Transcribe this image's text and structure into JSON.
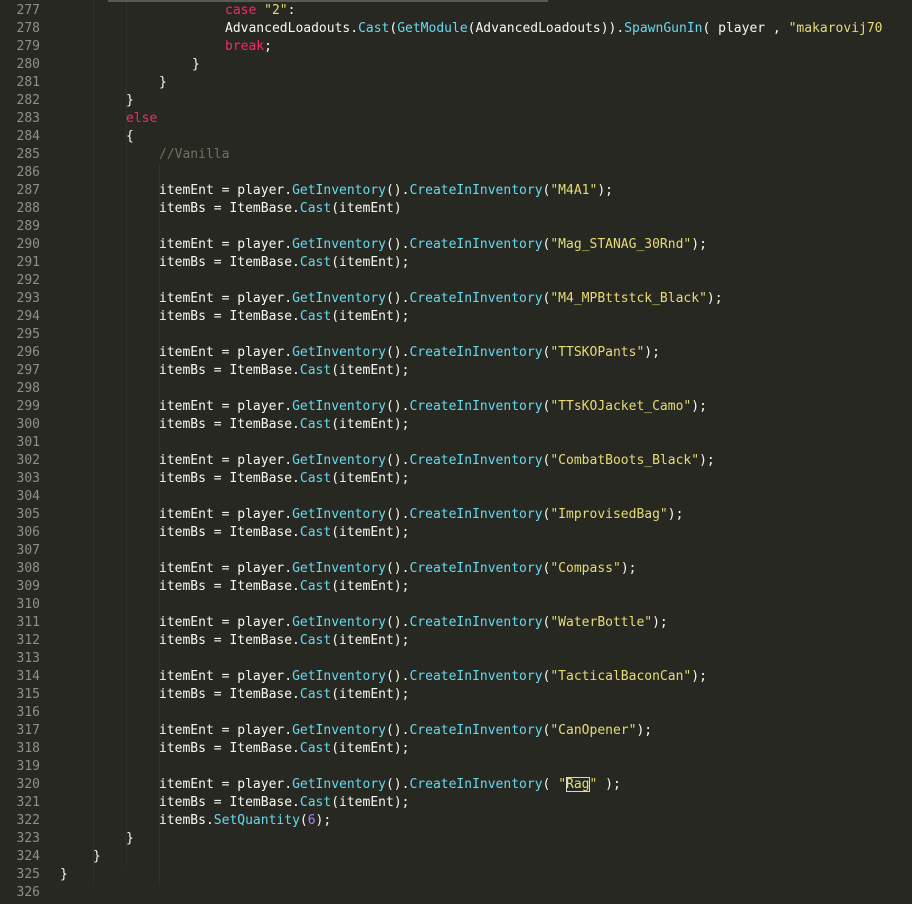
{
  "editor": {
    "colors": {
      "background": "#272822",
      "foreground": "#f8f8f2",
      "keyword": "#f92672",
      "string": "#e6db74",
      "function": "#66d9ef",
      "number": "#ae81ff",
      "comment": "#75715e",
      "gutter": "#90908a"
    },
    "lines": [
      {
        "num": "277",
        "indent": 5,
        "tokens": [
          {
            "t": "case ",
            "c": "kw"
          },
          {
            "t": "\"2\"",
            "c": "str"
          },
          {
            "t": ":"
          }
        ]
      },
      {
        "num": "278",
        "indent": 5,
        "tokens": [
          {
            "t": "AdvancedLoadouts."
          },
          {
            "t": "Cast",
            "c": "fn"
          },
          {
            "t": "("
          },
          {
            "t": "GetModule",
            "c": "fn"
          },
          {
            "t": "(AdvancedLoadouts))."
          },
          {
            "t": "SpawnGunIn",
            "c": "fn"
          },
          {
            "t": "( player , "
          },
          {
            "t": "\"makarovij70",
            "c": "str"
          }
        ]
      },
      {
        "num": "279",
        "indent": 5,
        "tokens": [
          {
            "t": "break",
            "c": "kw"
          },
          {
            "t": ";"
          }
        ]
      },
      {
        "num": "280",
        "indent": 4,
        "tokens": [
          {
            "t": "}"
          }
        ]
      },
      {
        "num": "281",
        "indent": 3,
        "tokens": [
          {
            "t": "}"
          }
        ]
      },
      {
        "num": "282",
        "indent": 2,
        "tokens": [
          {
            "t": "}"
          }
        ]
      },
      {
        "num": "283",
        "indent": 2,
        "tokens": [
          {
            "t": "else",
            "c": "kw"
          }
        ]
      },
      {
        "num": "284",
        "indent": 2,
        "tokens": [
          {
            "t": "{"
          }
        ]
      },
      {
        "num": "285",
        "indent": 3,
        "tokens": [
          {
            "t": "//Vanilla",
            "c": "cm"
          }
        ]
      },
      {
        "num": "286",
        "indent": 0,
        "tokens": []
      },
      {
        "num": "287",
        "indent": 3,
        "tokens": [
          {
            "t": "itemEnt = player."
          },
          {
            "t": "GetInventory",
            "c": "fn"
          },
          {
            "t": "()."
          },
          {
            "t": "CreateInInventory",
            "c": "fn"
          },
          {
            "t": "("
          },
          {
            "t": "\"M4A1\"",
            "c": "str"
          },
          {
            "t": ");"
          }
        ]
      },
      {
        "num": "288",
        "indent": 3,
        "tokens": [
          {
            "t": "itemBs = ItemBase."
          },
          {
            "t": "Cast",
            "c": "fn"
          },
          {
            "t": "(itemEnt)"
          }
        ]
      },
      {
        "num": "289",
        "indent": 0,
        "tokens": []
      },
      {
        "num": "290",
        "indent": 3,
        "tokens": [
          {
            "t": "itemEnt = player."
          },
          {
            "t": "GetInventory",
            "c": "fn"
          },
          {
            "t": "()."
          },
          {
            "t": "CreateInInventory",
            "c": "fn"
          },
          {
            "t": "("
          },
          {
            "t": "\"Mag_STANAG_30Rnd\"",
            "c": "str"
          },
          {
            "t": ");"
          }
        ]
      },
      {
        "num": "291",
        "indent": 3,
        "tokens": [
          {
            "t": "itemBs = ItemBase."
          },
          {
            "t": "Cast",
            "c": "fn"
          },
          {
            "t": "(itemEnt);"
          }
        ]
      },
      {
        "num": "292",
        "indent": 0,
        "tokens": []
      },
      {
        "num": "293",
        "indent": 3,
        "tokens": [
          {
            "t": "itemEnt = player."
          },
          {
            "t": "GetInventory",
            "c": "fn"
          },
          {
            "t": "()."
          },
          {
            "t": "CreateInInventory",
            "c": "fn"
          },
          {
            "t": "("
          },
          {
            "t": "\"M4_MPBttstck_Black\"",
            "c": "str"
          },
          {
            "t": ");"
          }
        ]
      },
      {
        "num": "294",
        "indent": 3,
        "tokens": [
          {
            "t": "itemBs = ItemBase."
          },
          {
            "t": "Cast",
            "c": "fn"
          },
          {
            "t": "(itemEnt);"
          }
        ]
      },
      {
        "num": "295",
        "indent": 0,
        "tokens": []
      },
      {
        "num": "296",
        "indent": 3,
        "tokens": [
          {
            "t": "itemEnt = player."
          },
          {
            "t": "GetInventory",
            "c": "fn"
          },
          {
            "t": "()."
          },
          {
            "t": "CreateInInventory",
            "c": "fn"
          },
          {
            "t": "("
          },
          {
            "t": "\"TTSKOPants\"",
            "c": "str"
          },
          {
            "t": ");"
          }
        ]
      },
      {
        "num": "297",
        "indent": 3,
        "tokens": [
          {
            "t": "itemBs = ItemBase."
          },
          {
            "t": "Cast",
            "c": "fn"
          },
          {
            "t": "(itemEnt);"
          }
        ]
      },
      {
        "num": "298",
        "indent": 0,
        "tokens": []
      },
      {
        "num": "299",
        "indent": 3,
        "tokens": [
          {
            "t": "itemEnt = player."
          },
          {
            "t": "GetInventory",
            "c": "fn"
          },
          {
            "t": "()."
          },
          {
            "t": "CreateInInventory",
            "c": "fn"
          },
          {
            "t": "("
          },
          {
            "t": "\"TTsKOJacket_Camo\"",
            "c": "str"
          },
          {
            "t": ");"
          }
        ]
      },
      {
        "num": "300",
        "indent": 3,
        "tokens": [
          {
            "t": "itemBs = ItemBase."
          },
          {
            "t": "Cast",
            "c": "fn"
          },
          {
            "t": "(itemEnt);"
          }
        ]
      },
      {
        "num": "301",
        "indent": 0,
        "tokens": []
      },
      {
        "num": "302",
        "indent": 3,
        "tokens": [
          {
            "t": "itemEnt = player."
          },
          {
            "t": "GetInventory",
            "c": "fn"
          },
          {
            "t": "()."
          },
          {
            "t": "CreateInInventory",
            "c": "fn"
          },
          {
            "t": "("
          },
          {
            "t": "\"CombatBoots_Black\"",
            "c": "str"
          },
          {
            "t": ");"
          }
        ]
      },
      {
        "num": "303",
        "indent": 3,
        "tokens": [
          {
            "t": "itemBs = ItemBase."
          },
          {
            "t": "Cast",
            "c": "fn"
          },
          {
            "t": "(itemEnt);"
          }
        ]
      },
      {
        "num": "304",
        "indent": 0,
        "tokens": []
      },
      {
        "num": "305",
        "indent": 3,
        "tokens": [
          {
            "t": "itemEnt = player."
          },
          {
            "t": "GetInventory",
            "c": "fn"
          },
          {
            "t": "()."
          },
          {
            "t": "CreateInInventory",
            "c": "fn"
          },
          {
            "t": "("
          },
          {
            "t": "\"ImprovisedBag\"",
            "c": "str"
          },
          {
            "t": ");"
          }
        ]
      },
      {
        "num": "306",
        "indent": 3,
        "tokens": [
          {
            "t": "itemBs = ItemBase."
          },
          {
            "t": "Cast",
            "c": "fn"
          },
          {
            "t": "(itemEnt);"
          }
        ]
      },
      {
        "num": "307",
        "indent": 0,
        "tokens": []
      },
      {
        "num": "308",
        "indent": 3,
        "tokens": [
          {
            "t": "itemEnt = player."
          },
          {
            "t": "GetInventory",
            "c": "fn"
          },
          {
            "t": "()."
          },
          {
            "t": "CreateInInventory",
            "c": "fn"
          },
          {
            "t": "("
          },
          {
            "t": "\"Compass\"",
            "c": "str"
          },
          {
            "t": ");"
          }
        ]
      },
      {
        "num": "309",
        "indent": 3,
        "tokens": [
          {
            "t": "itemBs = ItemBase."
          },
          {
            "t": "Cast",
            "c": "fn"
          },
          {
            "t": "(itemEnt);"
          }
        ]
      },
      {
        "num": "310",
        "indent": 0,
        "tokens": []
      },
      {
        "num": "311",
        "indent": 3,
        "tokens": [
          {
            "t": "itemEnt = player."
          },
          {
            "t": "GetInventory",
            "c": "fn"
          },
          {
            "t": "()."
          },
          {
            "t": "CreateInInventory",
            "c": "fn"
          },
          {
            "t": "("
          },
          {
            "t": "\"WaterBottle\"",
            "c": "str"
          },
          {
            "t": ");"
          }
        ]
      },
      {
        "num": "312",
        "indent": 3,
        "tokens": [
          {
            "t": "itemBs = ItemBase."
          },
          {
            "t": "Cast",
            "c": "fn"
          },
          {
            "t": "(itemEnt);"
          }
        ]
      },
      {
        "num": "313",
        "indent": 0,
        "tokens": []
      },
      {
        "num": "314",
        "indent": 3,
        "tokens": [
          {
            "t": "itemEnt = player."
          },
          {
            "t": "GetInventory",
            "c": "fn"
          },
          {
            "t": "()."
          },
          {
            "t": "CreateInInventory",
            "c": "fn"
          },
          {
            "t": "("
          },
          {
            "t": "\"TacticalBaconCan\"",
            "c": "str"
          },
          {
            "t": ");"
          }
        ]
      },
      {
        "num": "315",
        "indent": 3,
        "tokens": [
          {
            "t": "itemBs = ItemBase."
          },
          {
            "t": "Cast",
            "c": "fn"
          },
          {
            "t": "(itemEnt);"
          }
        ]
      },
      {
        "num": "316",
        "indent": 0,
        "tokens": []
      },
      {
        "num": "317",
        "indent": 3,
        "tokens": [
          {
            "t": "itemEnt = player."
          },
          {
            "t": "GetInventory",
            "c": "fn"
          },
          {
            "t": "()."
          },
          {
            "t": "CreateInInventory",
            "c": "fn"
          },
          {
            "t": "("
          },
          {
            "t": "\"CanOpener\"",
            "c": "str"
          },
          {
            "t": ");"
          }
        ]
      },
      {
        "num": "318",
        "indent": 3,
        "tokens": [
          {
            "t": "itemBs = ItemBase."
          },
          {
            "t": "Cast",
            "c": "fn"
          },
          {
            "t": "(itemEnt);"
          }
        ]
      },
      {
        "num": "319",
        "indent": 0,
        "tokens": []
      },
      {
        "num": "320",
        "indent": 3,
        "tokens": [
          {
            "t": "itemEnt = player."
          },
          {
            "t": "GetInventory",
            "c": "fn"
          },
          {
            "t": "()."
          },
          {
            "t": "CreateInInventory",
            "c": "fn"
          },
          {
            "t": "( "
          },
          {
            "t": "\"",
            "c": "str"
          },
          {
            "t": "Rag",
            "c": "str",
            "box": true
          },
          {
            "t": "\"",
            "c": "str"
          },
          {
            "t": " );"
          }
        ]
      },
      {
        "num": "321",
        "indent": 3,
        "tokens": [
          {
            "t": "itemBs = ItemBase."
          },
          {
            "t": "Cast",
            "c": "fn"
          },
          {
            "t": "(itemEnt);"
          }
        ]
      },
      {
        "num": "322",
        "indent": 3,
        "tokens": [
          {
            "t": "itemBs."
          },
          {
            "t": "SetQuantity",
            "c": "fn"
          },
          {
            "t": "("
          },
          {
            "t": "6",
            "c": "num"
          },
          {
            "t": ");"
          }
        ]
      },
      {
        "num": "323",
        "indent": 2,
        "tokens": [
          {
            "t": "}"
          }
        ]
      },
      {
        "num": "324",
        "indent": 1,
        "tokens": [
          {
            "t": "}"
          }
        ]
      },
      {
        "num": "325",
        "indent": 0,
        "tokens": [
          {
            "t": "}"
          }
        ]
      },
      {
        "num": "326",
        "indent": 0,
        "tokens": []
      }
    ]
  }
}
